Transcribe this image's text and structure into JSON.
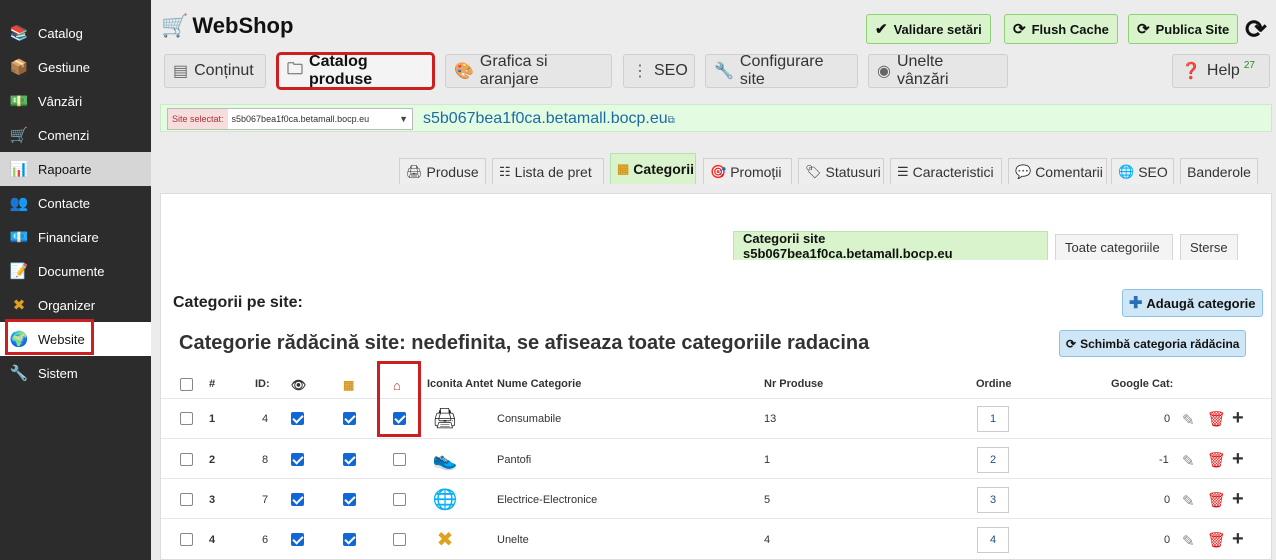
{
  "sidebar": {
    "items": [
      {
        "label": "Catalog",
        "icon": "books-icon"
      },
      {
        "label": "Gestiune",
        "icon": "boxes-icon"
      },
      {
        "label": "Vânzări",
        "icon": "hand-money-icon"
      },
      {
        "label": "Comenzi",
        "icon": "cart-icon"
      },
      {
        "label": "Rapoarte",
        "icon": "chart-icon"
      },
      {
        "label": "Contacte",
        "icon": "contacts-icon"
      },
      {
        "label": "Financiare",
        "icon": "money-icon"
      },
      {
        "label": "Documente",
        "icon": "document-icon"
      },
      {
        "label": "Organizer",
        "icon": "tools-icon"
      },
      {
        "label": "Website",
        "icon": "globe-icon"
      },
      {
        "label": "Sistem",
        "icon": "wrench-icon"
      }
    ]
  },
  "header": {
    "logo_text": "WebShop",
    "buttons": {
      "validate": "Validare setări",
      "flush": "Flush Cache",
      "publish": "Publica Site"
    }
  },
  "main_tabs": {
    "continut": "Conținut",
    "catalog": "Catalog produse",
    "grafica": "Grafica si aranjare",
    "seo": "SEO",
    "configurare": "Configurare site",
    "unelte": "Unelte vânzări",
    "help": "Help",
    "help_badge": "27"
  },
  "sitebar": {
    "select_label": "Site selectat:",
    "select_value": "s5b067bea1f0ca.betamall.bocp.eu",
    "link": "s5b067bea1f0ca.betamall.bocp.eu"
  },
  "sub_tabs": {
    "produse": "Produse",
    "lista": "Lista de pret",
    "categorii": "Categorii",
    "promotii": "Promoții",
    "statusuri": "Statusuri",
    "caracteristici": "Caracteristici",
    "comentarii": "Comentarii",
    "seo": "SEO",
    "banderole": "Banderole"
  },
  "panel": {
    "inner_tabs": {
      "site": "Categorii site s5b067bea1f0ca.betamall.bocp.eu",
      "toate": "Toate categoriile",
      "sterse": "Sterse"
    },
    "section_title": "Categorii pe site:",
    "add_button": "Adaugă categorie",
    "root_title": "Categorie rădăcină site: nedefinita, se afiseaza toate categoriile radacina",
    "change_root_button": "Schimbă categoria rădăcina",
    "columns": {
      "num": "#",
      "id": "ID:",
      "icon_header": "Iconita Antet",
      "name": "Nume Categorie",
      "nr_produse": "Nr Produse",
      "ordine": "Ordine",
      "google": "Google Cat:"
    },
    "rows": [
      {
        "num": "1",
        "id": "4",
        "visible": true,
        "catalog": true,
        "home": true,
        "icon": "consumables-icon",
        "name": "Consumabile",
        "nr": "13",
        "order": "1",
        "google": "0"
      },
      {
        "num": "2",
        "id": "8",
        "visible": true,
        "catalog": true,
        "home": false,
        "icon": "shoe-icon",
        "name": "Pantofi",
        "nr": "1",
        "order": "2",
        "google": "-1"
      },
      {
        "num": "3",
        "id": "7",
        "visible": true,
        "catalog": true,
        "home": false,
        "icon": "globe-icon",
        "name": "Electrice-Electronice",
        "nr": "5",
        "order": "3",
        "google": "0"
      },
      {
        "num": "4",
        "id": "6",
        "visible": true,
        "catalog": true,
        "home": false,
        "icon": "tools-icon",
        "name": "Unelte",
        "nr": "4",
        "order": "4",
        "google": "0"
      }
    ]
  },
  "colors": {
    "sidebar_bg": "#2c2c2c",
    "green_btn": "#d9f4cc",
    "blue_btn": "#cfe6f7",
    "highlight_red": "#cc1f1f",
    "checkbox_blue": "#1167d6"
  }
}
